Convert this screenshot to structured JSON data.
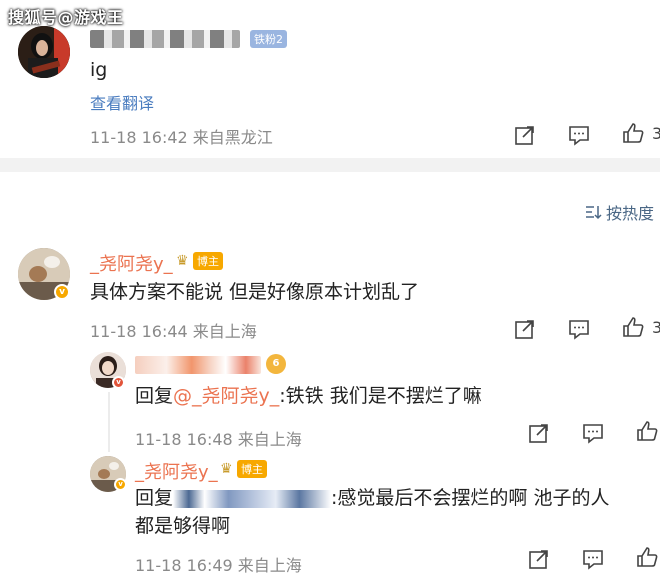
{
  "watermark": "搜狐号@游戏王",
  "comment1": {
    "avatar": "avatar",
    "fan_badge": "铁粉2",
    "text": "ig",
    "translate_link": "查看翻译",
    "meta": "11-18 16:42 来自黑龙江",
    "like_count": "3"
  },
  "sort": {
    "label": "按热度"
  },
  "comment2": {
    "author": "_尧阿尧y_",
    "host_badge": "博主",
    "text": "具体方案不能说 但是好像原本计划乱了",
    "meta": "11-18 16:44 来自上海",
    "like_count": "3"
  },
  "reply1": {
    "prefix": "回复",
    "mention": "@_尧阿尧y_",
    "text": ":铁铁 我们是不摆烂了嘛",
    "meta": "11-18 16:48 来自上海",
    "level_badge": "6"
  },
  "reply2": {
    "author": "_尧阿尧y_",
    "host_badge": "博主",
    "prefix": "回复",
    "text_line1": ":感觉最后不会摆烂的啊 池子的人",
    "text_line2": "都是够得啊",
    "meta": "11-18 16:49 来自上海"
  },
  "icons": [
    "share-icon",
    "comment-icon",
    "like-icon"
  ],
  "colors": {
    "accent": "#eb7350",
    "link": "#4a7cbf",
    "meta": "#8a8a8a",
    "host": "#f7a800"
  }
}
